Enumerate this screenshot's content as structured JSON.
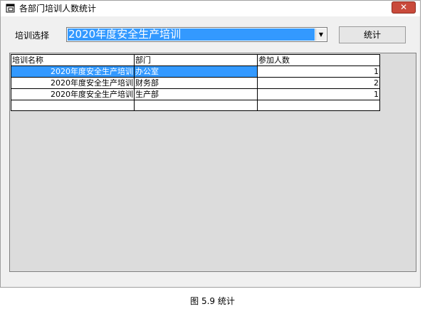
{
  "window": {
    "title": "各部门培训人数统计",
    "close_label": "✕"
  },
  "form": {
    "select_label": "培训选择",
    "selected_training": "2020年度安全生产培训",
    "stat_button": "统计"
  },
  "grid": {
    "columns": [
      "培训名称",
      "部门",
      "参加人数"
    ],
    "rows": [
      {
        "name": "2020年度安全生产培训",
        "dept": "办公室",
        "count": "1"
      },
      {
        "name": "2020年度安全生产培训",
        "dept": "财务部",
        "count": "2"
      },
      {
        "name": "2020年度安全生产培训",
        "dept": "生产部",
        "count": "1"
      },
      {
        "name": "",
        "dept": "",
        "count": ""
      }
    ]
  },
  "caption": "图 5.9 统计",
  "icons": {
    "app": "window-app-icon",
    "dropdown": "chevron-down-icon"
  },
  "colors": {
    "selection": "#3399ff",
    "close_button": "#c94a3b"
  }
}
